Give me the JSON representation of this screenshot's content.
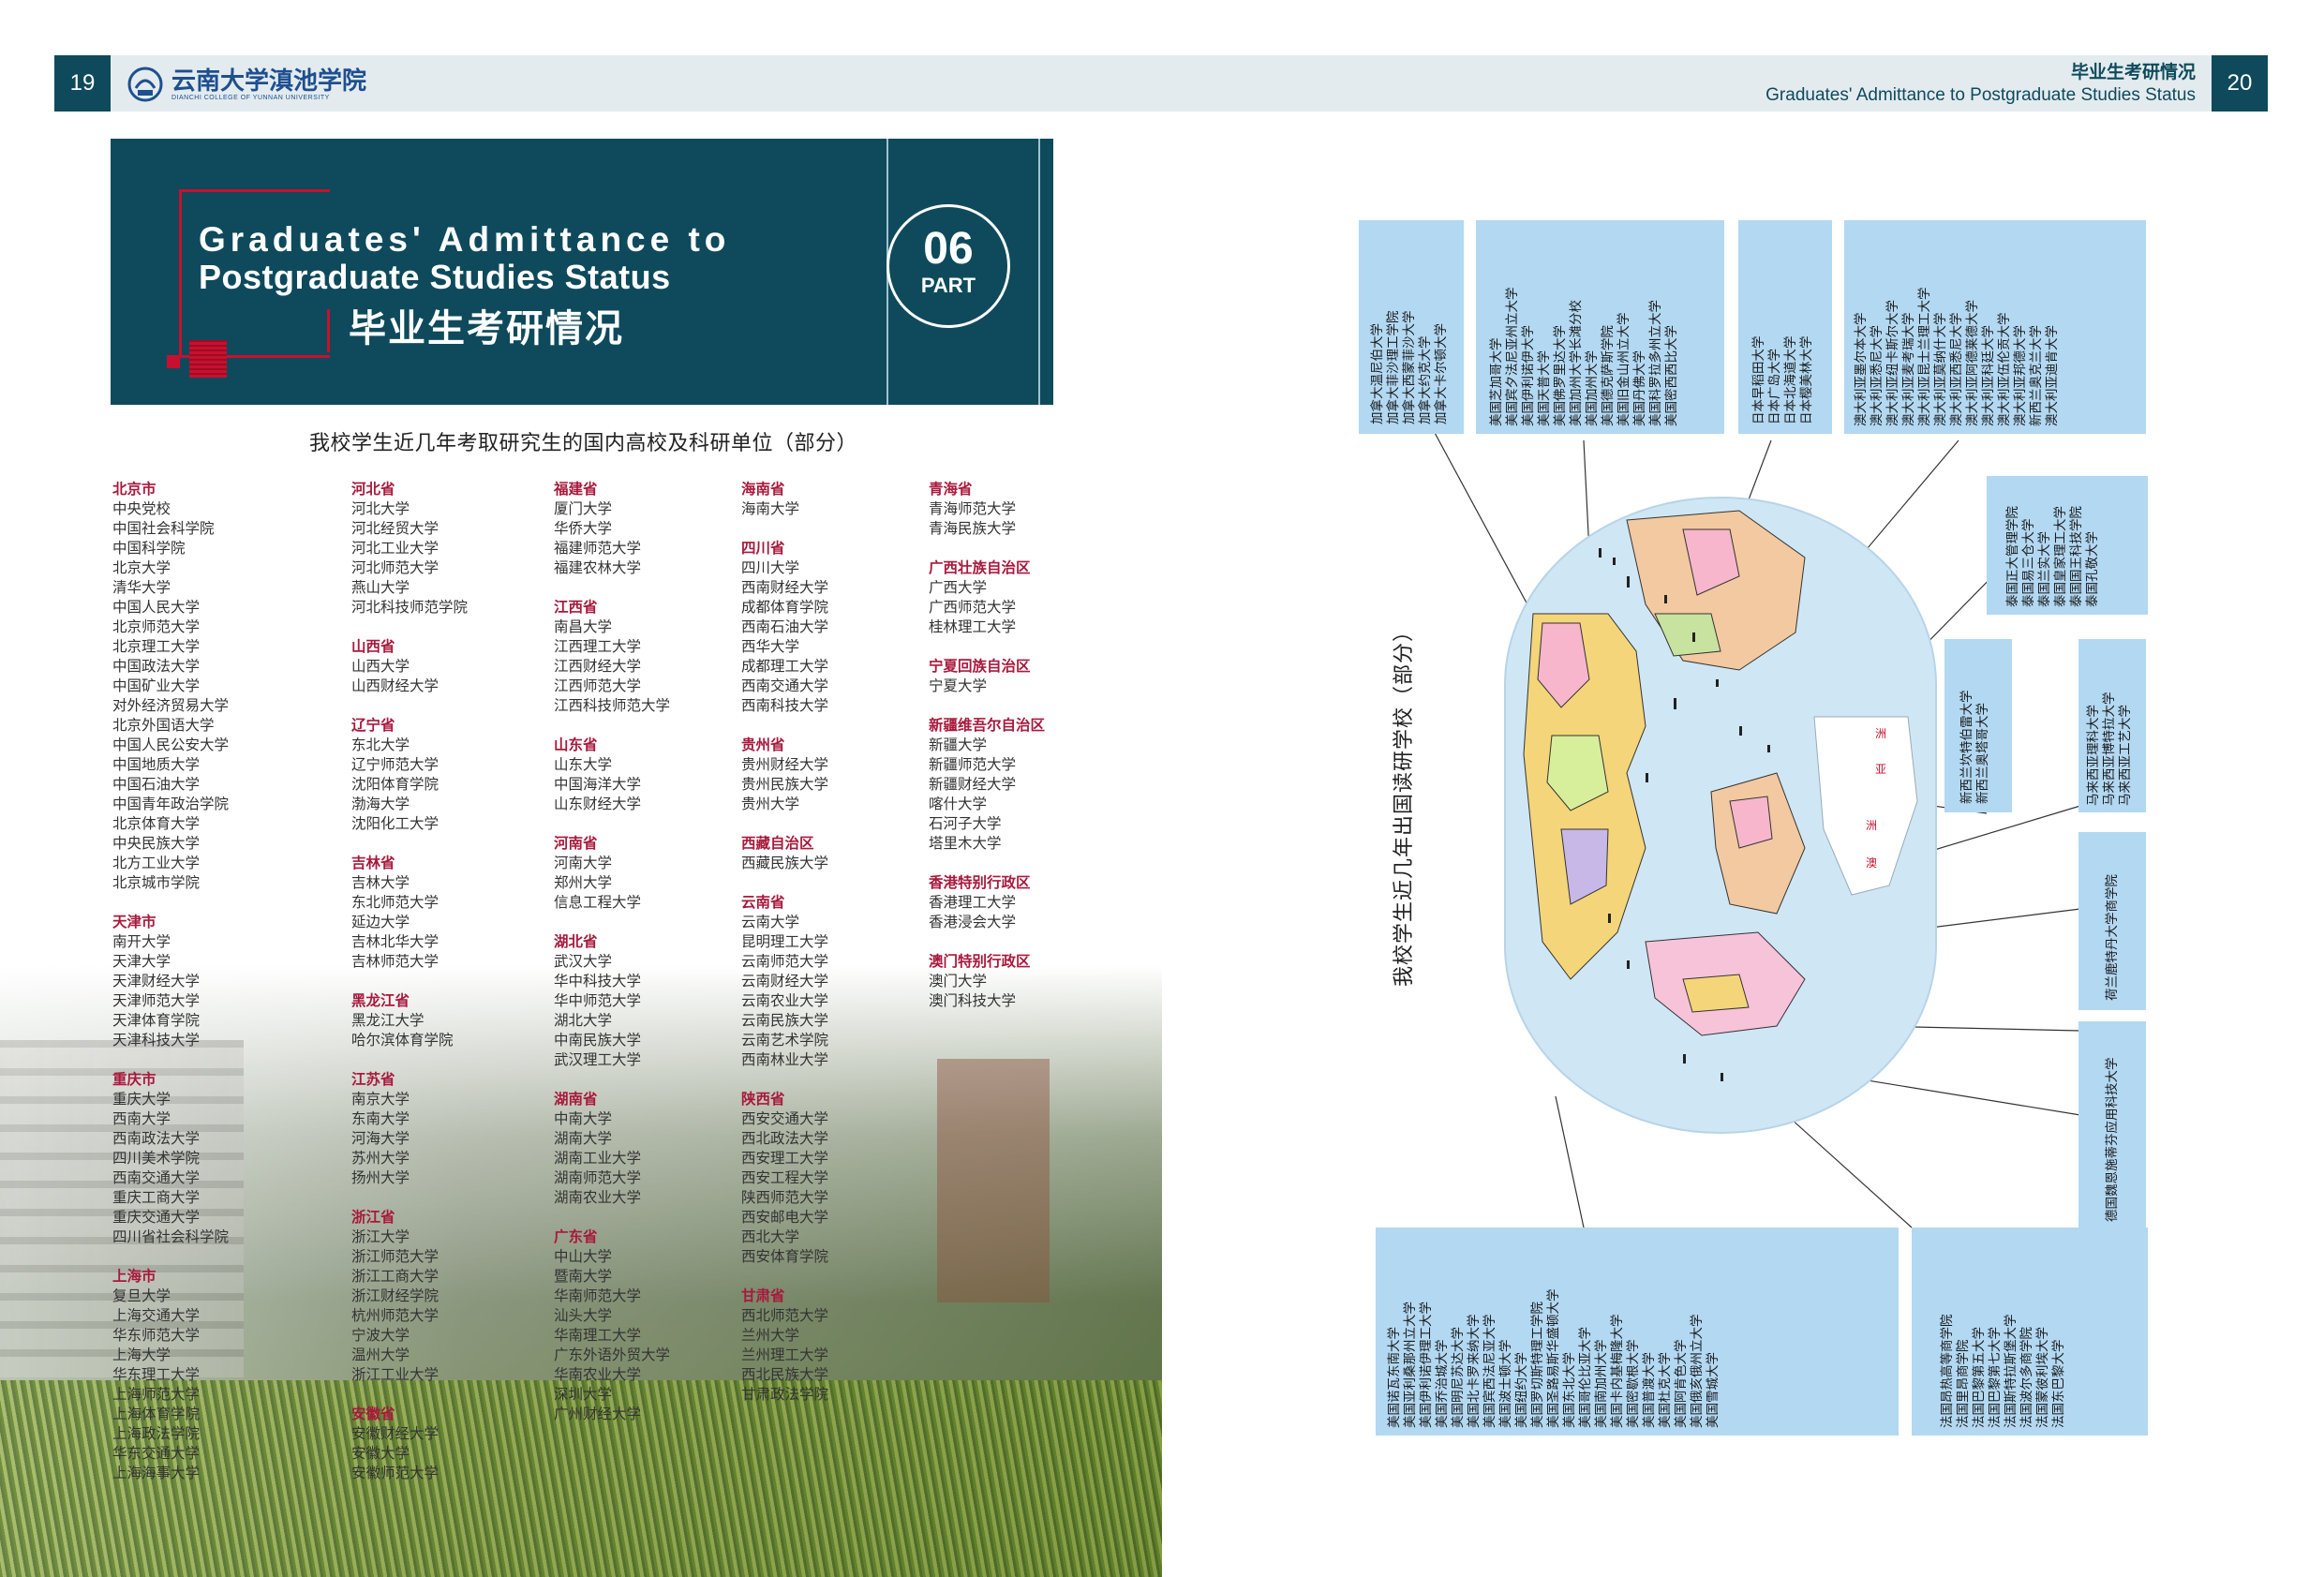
{
  "header": {
    "page_left": "19",
    "page_right": "20",
    "logo_cn": "云南大学滇池学院",
    "logo_en": "DIANCHI COLLEGE OF YUNNAN UNIVERSITY",
    "title_cn": "毕业生考研情况",
    "title_en": "Graduates' Admittance to Postgraduate Studies Status"
  },
  "banner": {
    "en_line1": "Graduates' Admittance to",
    "en_line2": "Postgraduate Studies Status",
    "cn": "毕业生考研情况",
    "num": "06",
    "part": "PART"
  },
  "domestic": {
    "title": "我校学生近几年考取研究生的国内高校及科研单位（部分）",
    "columns": [
      [
        {
          "name": "北京市",
          "items": [
            "中央党校",
            "中国社会科学院",
            "中国科学院",
            "北京大学",
            "清华大学",
            "中国人民大学",
            "北京师范大学",
            "北京理工大学",
            "中国政法大学",
            "中国矿业大学",
            "对外经济贸易大学",
            "北京外国语大学",
            "中国人民公安大学",
            "中国地质大学",
            "中国石油大学",
            "中国青年政治学院",
            "北京体育大学",
            "中央民族大学",
            "北方工业大学",
            "北京城市学院"
          ]
        },
        {
          "name": "天津市",
          "items": [
            "南开大学",
            "天津大学",
            "天津财经大学",
            "天津师范大学",
            "天津体育学院",
            "天津科技大学"
          ]
        },
        {
          "name": "重庆市",
          "items": [
            "重庆大学",
            "西南大学",
            "西南政法大学",
            "四川美术学院",
            "西南交通大学",
            "重庆工商大学",
            "重庆交通大学",
            "四川省社会科学院"
          ]
        },
        {
          "name": "上海市",
          "items": [
            "复旦大学",
            "上海交通大学",
            "华东师范大学",
            "上海大学",
            "华东理工大学",
            "上海师范大学",
            "上海体育学院",
            "上海政法学院",
            "华东交通大学",
            "上海海事大学"
          ]
        }
      ],
      [
        {
          "name": "河北省",
          "items": [
            "河北大学",
            "河北经贸大学",
            "河北工业大学",
            "河北师范大学",
            "燕山大学",
            "河北科技师范学院"
          ]
        },
        {
          "name": "山西省",
          "items": [
            "山西大学",
            "山西财经大学"
          ]
        },
        {
          "name": "辽宁省",
          "items": [
            "东北大学",
            "辽宁师范大学",
            "沈阳体育学院",
            "渤海大学",
            "沈阳化工大学"
          ]
        },
        {
          "name": "吉林省",
          "items": [
            "吉林大学",
            "东北师范大学",
            "延边大学",
            "吉林北华大学",
            "吉林师范大学"
          ]
        },
        {
          "name": "黑龙江省",
          "items": [
            "黑龙江大学",
            "哈尔滨体育学院"
          ]
        },
        {
          "name": "江苏省",
          "items": [
            "南京大学",
            "东南大学",
            "河海大学",
            "苏州大学",
            "扬州大学"
          ]
        },
        {
          "name": "浙江省",
          "items": [
            "浙江大学",
            "浙江师范大学",
            "浙江工商大学",
            "浙江财经学院",
            "杭州师范大学",
            "宁波大学",
            "温州大学",
            "浙江工业大学"
          ]
        },
        {
          "name": "安徽省",
          "items": [
            "安徽财经大学",
            "安徽大学",
            "安徽师范大学"
          ]
        }
      ],
      [
        {
          "name": "福建省",
          "items": [
            "厦门大学",
            "华侨大学",
            "福建师范大学",
            "福建农林大学"
          ]
        },
        {
          "name": "江西省",
          "items": [
            "南昌大学",
            "江西理工大学",
            "江西财经大学",
            "江西师范大学",
            "江西科技师范大学"
          ]
        },
        {
          "name": "山东省",
          "items": [
            "山东大学",
            "中国海洋大学",
            "山东财经大学"
          ]
        },
        {
          "name": "河南省",
          "items": [
            "河南大学",
            "郑州大学",
            "信息工程大学"
          ]
        },
        {
          "name": "湖北省",
          "items": [
            "武汉大学",
            "华中科技大学",
            "华中师范大学",
            "湖北大学",
            "中南民族大学",
            "武汉理工大学"
          ]
        },
        {
          "name": "湖南省",
          "items": [
            "中南大学",
            "湖南大学",
            "湖南工业大学",
            "湖南师范大学",
            "湖南农业大学"
          ]
        },
        {
          "name": "广东省",
          "items": [
            "中山大学",
            "暨南大学",
            "华南师范大学",
            "汕头大学",
            "华南理工大学",
            "广东外语外贸大学",
            "华南农业大学",
            "深圳大学",
            "广州财经大学"
          ]
        }
      ],
      [
        {
          "name": "海南省",
          "items": [
            "海南大学"
          ]
        },
        {
          "name": "四川省",
          "items": [
            "四川大学",
            "西南财经大学",
            "成都体育学院",
            "西南石油大学",
            "西华大学",
            "成都理工大学",
            "西南交通大学",
            "西南科技大学"
          ]
        },
        {
          "name": "贵州省",
          "items": [
            "贵州财经大学",
            "贵州民族大学",
            "贵州大学"
          ]
        },
        {
          "name": "西藏自治区",
          "items": [
            "西藏民族大学"
          ]
        },
        {
          "name": "云南省",
          "items": [
            "云南大学",
            "昆明理工大学",
            "云南师范大学",
            "云南财经大学",
            "云南农业大学",
            "云南民族大学",
            "云南艺术学院",
            "西南林业大学"
          ]
        },
        {
          "name": "陕西省",
          "items": [
            "西安交通大学",
            "西北政法大学",
            "西安理工大学",
            "西安工程大学",
            "陕西师范大学",
            "西安邮电大学",
            "西北大学",
            "西安体育学院"
          ]
        },
        {
          "name": "甘肃省",
          "items": [
            "西北师范大学",
            "兰州大学",
            "兰州理工大学",
            "西北民族大学",
            "甘肃政法学院"
          ]
        }
      ],
      [
        {
          "name": "青海省",
          "items": [
            "青海师范大学",
            "青海民族大学"
          ]
        },
        {
          "name": "广西壮族自治区",
          "items": [
            "广西大学",
            "广西师范大学",
            "桂林理工大学"
          ]
        },
        {
          "name": "宁夏回族自治区",
          "items": [
            "宁夏大学"
          ]
        },
        {
          "name": "新疆维吾尔自治区",
          "items": [
            "新疆大学",
            "新疆师范大学",
            "新疆财经大学",
            "喀什大学",
            "石河子大学",
            "塔里木大学"
          ]
        },
        {
          "name": "香港特别行政区",
          "items": [
            "香港理工大学",
            "香港浸会大学"
          ]
        },
        {
          "name": "澳门特别行政区",
          "items": [
            "澳门大学",
            "澳门科技大学"
          ]
        }
      ]
    ]
  },
  "abroad": {
    "title": "我校学生近几年出国读研学校（部分）",
    "canada": [
      "加拿大温尼伯大学",
      "加拿大菲沙理工学院",
      "加拿大西蒙菲沙大学",
      "加拿大约克大学",
      "加拿大卡尔顿大学"
    ],
    "usa_top": [
      "美国芝加哥大学",
      "美国宾夕法尼亚州立大学",
      "美国伊利诺伊大学",
      "美国天普大学",
      "美国佛罗里达大学",
      "美国加州大学长滩分校",
      "美国加州大学",
      "美国德克萨斯学院",
      "美国旧金山州立大学",
      "美国丹佛大学",
      "美国科罗拉多州立大学",
      "美国密西西比大学"
    ],
    "japan": [
      "日本早稻田大学",
      "日本广岛大学",
      "日本北海道大学",
      "日本樱美林大学"
    ],
    "australia": [
      "澳大利亚墨尔本大学",
      "澳大利亚悉尼大学",
      "澳大利亚纽卡斯尔大学",
      "澳大利亚麦考瑞大学",
      "澳大利亚昆士兰理工大学",
      "澳大利亚莫纳什大学",
      "澳大利亚西悉尼大学",
      "澳大利亚阿德莱德大学",
      "澳大利亚科廷大学",
      "澳大利亚伍伦贡大学",
      "澳大利亚邦德大学",
      "新西兰奥克兰大学",
      "澳大利亚迪肯大学"
    ],
    "thailand": [
      "泰国正大管理学院",
      "泰国易三仓大学",
      "泰国兰实大学",
      "泰国皇家理工大学",
      "泰国国王科技学院",
      "泰国孔敬大学"
    ],
    "nz": [
      "新西兰坎特伯雷大学",
      "新西兰奥塔哥大学"
    ],
    "malaysia": [
      "马来西亚理科大学",
      "马来西亚博特拉大学",
      "马来西亚工艺大学"
    ],
    "netherlands": [
      "荷兰鹿特丹大学商学院"
    ],
    "germany": [
      "德国魏恩施蒂芬应用科技大学"
    ],
    "usa_bottom": [
      "美国诺瓦东南大学",
      "美国亚利桑那州立大学",
      "美国伊利诺伊理工大学",
      "美国乔治城大学",
      "美国明尼苏达大学",
      "美国北卡罗来纳大学",
      "美国宾西法尼亚大学",
      "美国波士顿大学",
      "美国纽约大学",
      "美国罗切斯特理工学院",
      "美国圣路易斯华盛顿大学",
      "美国东北大学",
      "美国哥伦比亚大学",
      "美国南加州大学",
      "美国卡内基梅隆大学",
      "美国密歇根大学",
      "美国普渡大学",
      "美国杜克大学",
      "美国阿肯色大学",
      "美国俄亥俄州立大学",
      "美国雪城大学"
    ],
    "france": [
      "法国昂热高等商学院",
      "法国里昂商学院",
      "法国巴黎第五大学",
      "法国巴黎第七大学",
      "法国斯特拉斯堡大学",
      "法国波尔多商学院",
      "法国蒙彼利埃大学",
      "法国东巴黎大学"
    ],
    "map_labels": [
      "洲",
      "亚",
      "洲",
      "澳"
    ]
  }
}
